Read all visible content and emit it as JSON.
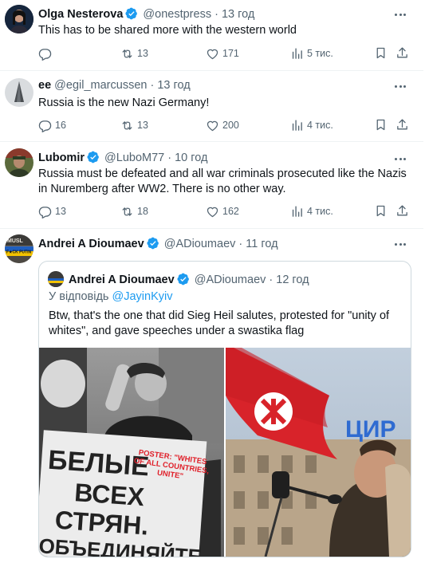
{
  "colors": {
    "accent": "#1d9bf0",
    "text": "#0f1419",
    "muted": "#536471",
    "border": "#eff3f4"
  },
  "tweets": [
    {
      "name": "Olga Nesterova",
      "handle": "@onestpress",
      "time": "· 13 год",
      "text": "This has to be shared more with the western world",
      "replies": "",
      "retweets": "13",
      "likes": "171",
      "views": "5 тис."
    },
    {
      "name": "ee",
      "handle": "@egil_marcussen",
      "time": "· 13 год",
      "text": "Russia is the new Nazi Germany!",
      "replies": "16",
      "retweets": "13",
      "likes": "200",
      "views": "4 тис."
    },
    {
      "name": "Lubomir",
      "handle": "@LuboM77",
      "time": "· 10 год",
      "text": "Russia must be defeated and all war criminals prosecuted like the Nazis in Nuremberg after WW2. There is no other way.",
      "replies": "13",
      "retweets": "18",
      "likes": "162",
      "views": "4 тис."
    },
    {
      "name": "Andrei A Dioumaev",
      "handle": "@ADioumaev",
      "time": "· 11 год"
    }
  ],
  "quote": {
    "name": "Andrei A Dioumaev",
    "handle": "@ADioumaev",
    "time": "· 12 год",
    "reply_prefix": "У відповідь",
    "reply_to": "@JayinKyiv",
    "text": "Btw, that's the one that did Sieg Heil salutes, protested for \"unity of whites\", and gave speeches under a swastika flag",
    "poster_lines": [
      "БЕЛЫЕ",
      "ВСЕХ",
      "СТРЯН.",
      "ОБЪЕДИНЯЙТЕ"
    ],
    "poster_caption": "POSTER: \"WHITES OF ALL COUNTRIES, UNITE\"",
    "building_sign": "ЦИР"
  },
  "avatar4_badge": "F★CK PUTIN",
  "avatar4_top": "MUSL"
}
